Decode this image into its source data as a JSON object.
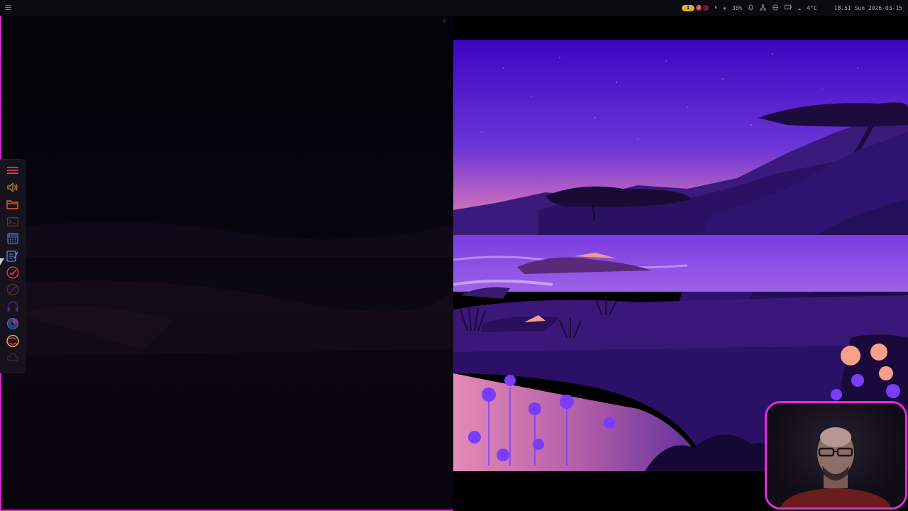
{
  "topbar": {
    "workspace_active": "1",
    "workspace_alert": "2",
    "volume": "38%",
    "weather": "4°C",
    "clock": "18.51 Sun 2026-03-15",
    "icons": [
      "menu-icon",
      "pause-icon",
      "volume-icon",
      "bell-icon",
      "network-icon",
      "vpn-icon",
      "battery-icon",
      "cloud-icon"
    ]
  },
  "dock": {
    "items": [
      "hamburger-menu-icon",
      "speaker-icon",
      "folder-icon",
      "terminal-icon",
      "calculator-icon",
      "notes-icon",
      "todo-check-icon",
      "compass-icon",
      "headphones-icon",
      "disk-icon",
      "browser-icon",
      "cloud-sync-icon"
    ]
  },
  "colors": {
    "accent_border": "#d629c8",
    "sky_top": "#3e06c4",
    "sky_mid": "#7a3fd6",
    "horizon": "#c766b8",
    "water": "#8a52e6",
    "ground": "#2a105e",
    "ws_active": "#d8b22b",
    "ws_alert": "#d03a48"
  }
}
